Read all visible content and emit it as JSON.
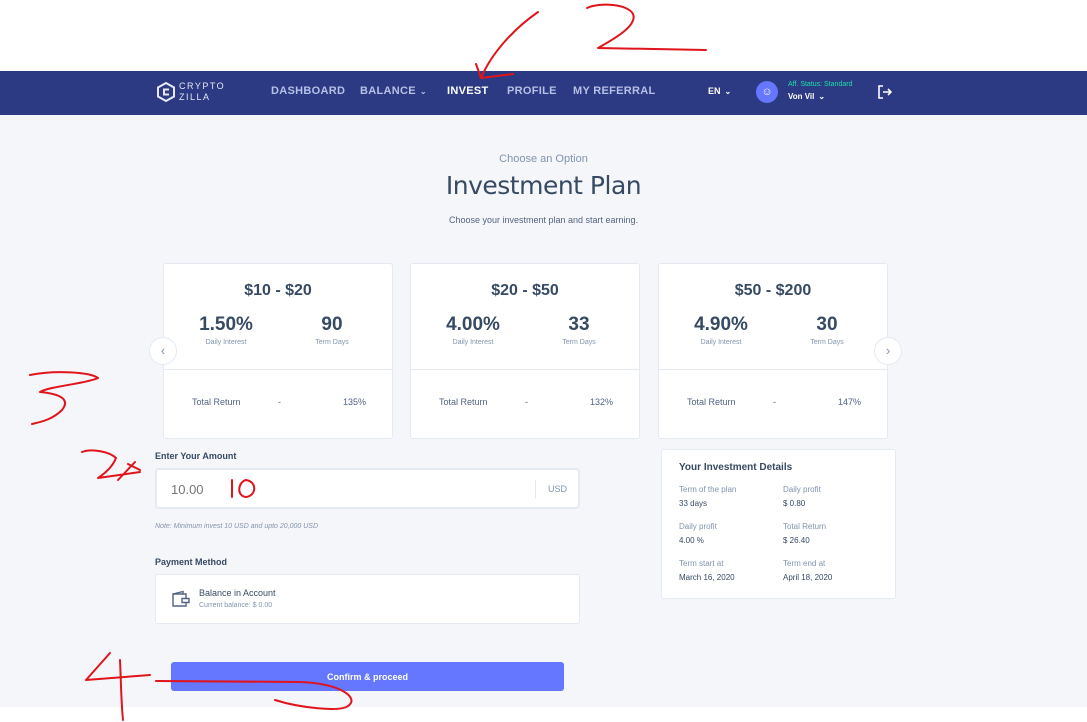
{
  "nav": {
    "logo_line1": "CRYPTO",
    "logo_line2": "ZILLA",
    "items": [
      {
        "label": "DASHBOARD"
      },
      {
        "label": "BALANCE"
      },
      {
        "label": "INVEST"
      },
      {
        "label": "PROFILE"
      },
      {
        "label": "MY REFERRAL"
      }
    ],
    "lang": "EN",
    "aff_status": "Aff. Status: Standard",
    "user_name": "Von Vil"
  },
  "header": {
    "subtitle": "Choose an Option",
    "title": "Investment Plan",
    "description": "Choose your investment plan and start earning."
  },
  "plans": [
    {
      "range": "$10 - $20",
      "interest": "1.50%",
      "interest_label": "Daily Interest",
      "days": "90",
      "days_label": "Term Days",
      "return_label": "Total Return",
      "dash": "-",
      "return": "135%"
    },
    {
      "range": "$20 - $50",
      "interest": "4.00%",
      "interest_label": "Daily Interest",
      "days": "33",
      "days_label": "Term Days",
      "return_label": "Total Return",
      "dash": "-",
      "return": "132%"
    },
    {
      "range": "$50 - $200",
      "interest": "4.90%",
      "interest_label": "Daily Interest",
      "days": "30",
      "days_label": "Term Days",
      "return_label": "Total Return",
      "dash": "-",
      "return": "147%"
    }
  ],
  "amount": {
    "label": "Enter Your Amount",
    "placeholder": "10.00",
    "currency": "USD",
    "note": "Note: Minimum invest 10 USD and upto 20,000 USD"
  },
  "payment": {
    "label": "Payment Method",
    "title": "Balance in Account",
    "subtitle": "Current balance: $ 0.00"
  },
  "confirm_label": "Confirm & proceed",
  "details": {
    "title": "Your Investment Details",
    "items": [
      {
        "label": "Term of the plan",
        "value": "33 days"
      },
      {
        "label": "Daily profit",
        "value": "$ 0.80"
      },
      {
        "label": "Daily profit",
        "value": "4.00 %"
      },
      {
        "label": "Total Return",
        "value": "$ 26.40"
      },
      {
        "label": "Term start at",
        "value": "March 16, 2020"
      },
      {
        "label": "Term end at",
        "value": "April 18, 2020"
      }
    ]
  },
  "annotation_color": "#e0141b",
  "icons": [
    "logo-icon",
    "chevron-down-icon",
    "user-icon",
    "logout-icon",
    "chevron-left-icon",
    "chevron-right-icon",
    "wallet-icon"
  ]
}
